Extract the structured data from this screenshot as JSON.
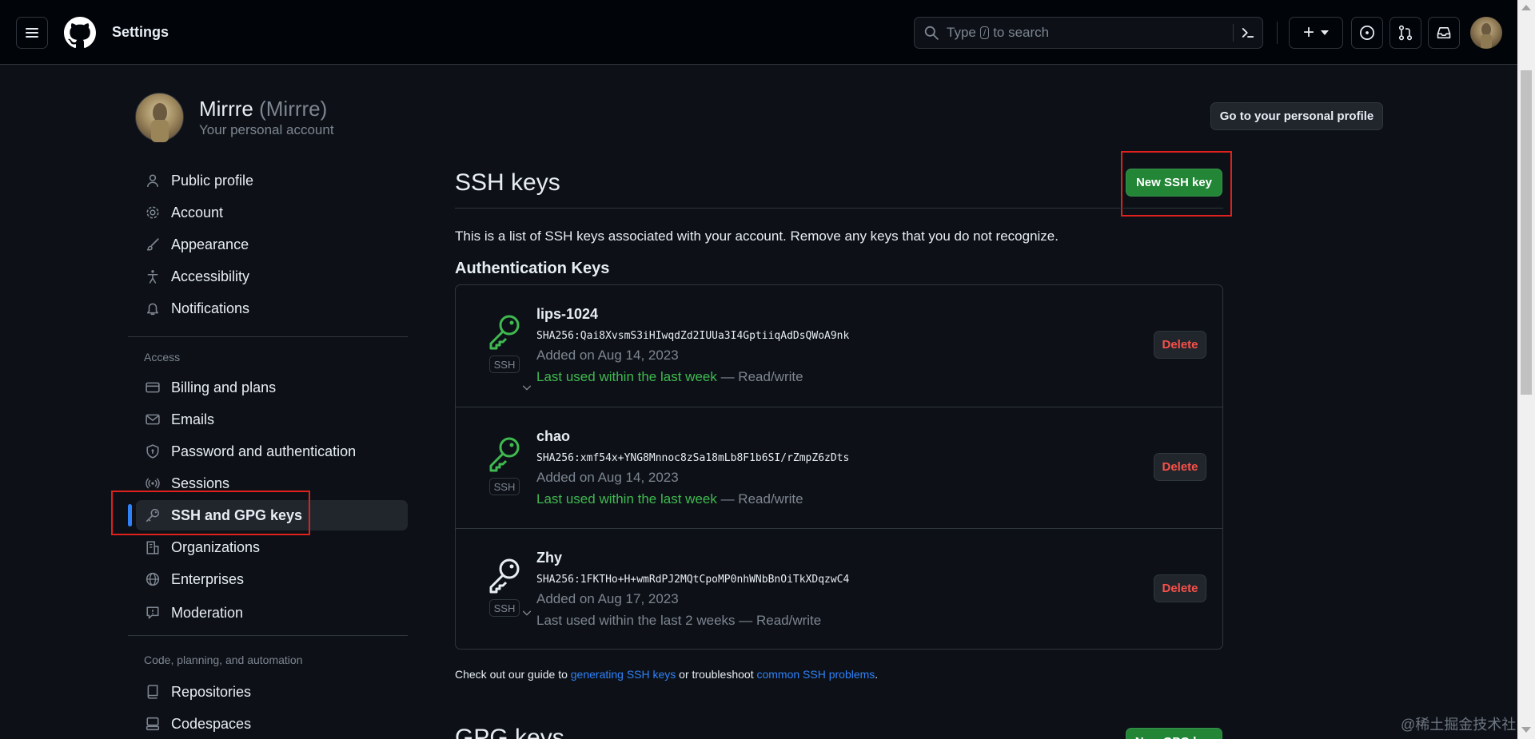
{
  "header": {
    "title": "Settings",
    "search": {
      "prefix": "Type",
      "key": "/",
      "suffix": "to search"
    },
    "add_label": "+"
  },
  "profile": {
    "name": "Mirrre",
    "handle": "(Mirrre)",
    "subtitle": "Your personal account",
    "profile_button": "Go to your personal profile"
  },
  "sidebar": {
    "items_top": [
      {
        "label": "Public profile",
        "icon": "person-icon"
      },
      {
        "label": "Account",
        "icon": "gear-icon"
      },
      {
        "label": "Appearance",
        "icon": "paintbrush-icon"
      },
      {
        "label": "Accessibility",
        "icon": "accessibility-icon"
      },
      {
        "label": "Notifications",
        "icon": "bell-icon"
      }
    ],
    "access_heading": "Access",
    "access_items": [
      {
        "label": "Billing and plans",
        "icon": "credit-card-icon"
      },
      {
        "label": "Emails",
        "icon": "mail-icon"
      },
      {
        "label": "Password and authentication",
        "icon": "shield-lock-icon"
      },
      {
        "label": "Sessions",
        "icon": "broadcast-icon"
      },
      {
        "label": "SSH and GPG keys",
        "icon": "key-icon"
      },
      {
        "label": "Organizations",
        "icon": "organization-icon"
      },
      {
        "label": "Enterprises",
        "icon": "globe-icon"
      },
      {
        "label": "Moderation",
        "icon": "report-icon"
      }
    ],
    "code_heading": "Code, planning, and automation",
    "code_items": [
      {
        "label": "Repositories",
        "icon": "repo-icon"
      },
      {
        "label": "Codespaces",
        "icon": "codespaces-icon"
      }
    ]
  },
  "main": {
    "title": "SSH keys",
    "new_button": "New SSH key",
    "description": "This is a list of SSH keys associated with your account. Remove any keys that you do not recognize.",
    "auth_heading": "Authentication Keys",
    "keys": [
      {
        "title": "lips-1024",
        "fingerprint": "SHA256:Qai8XvsmS3iHIwqdZd2IUUa3I4GptiiqAdDsQWoA9nk",
        "added": "Added on Aug 14, 2023",
        "used_recent": "Last used within the last week",
        "used_other": "",
        "access": " — Read/write",
        "badge": "SSH",
        "delete": "Delete",
        "icon_color": "#3fb950"
      },
      {
        "title": "chao",
        "fingerprint": "SHA256:xmf54x+YNG8Mnnoc8zSa18mLb8F1b6SI/rZmpZ6zDts",
        "added": "Added on Aug 14, 2023",
        "used_recent": "Last used within the last week",
        "used_other": "",
        "access": " — Read/write",
        "badge": "SSH",
        "delete": "Delete",
        "icon_color": "#3fb950"
      },
      {
        "title": "Zhy",
        "fingerprint": "SHA256:1FKTHo+H+wmRdPJ2MQtCpoMP0nhWNbBnOiTkXDqzwC4",
        "added": "Added on Aug 17, 2023",
        "used_recent": "",
        "used_other": "Last used within the last 2 weeks",
        "access": " — Read/write",
        "badge": "SSH",
        "delete": "Delete",
        "icon_color": "#e6edf3"
      }
    ],
    "footer": {
      "prefix": "Check out our guide to ",
      "link1": "generating SSH keys",
      "middle": " or troubleshoot ",
      "link2": "common SSH problems",
      "suffix": "."
    },
    "gpg_title": "GPG keys",
    "gpg_button": "New GPG key"
  },
  "watermark": "@稀土掘金技术社区",
  "colors": {
    "background": "#0d1117",
    "header_bg": "#010409",
    "accent_green": "#238636",
    "used_green": "#3fb950",
    "danger": "#f85149",
    "link": "#2f81f7",
    "highlight_box": "#e0201c"
  }
}
